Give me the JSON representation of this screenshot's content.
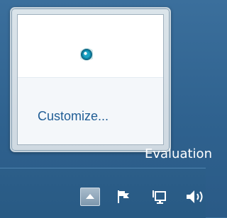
{
  "flyout": {
    "icons": [
      "tray-app-icon"
    ],
    "customize_label": "Customize..."
  },
  "desktop": {
    "watermark_text": "Evaluation"
  },
  "taskbar": {
    "tray_icons": [
      "show-hidden-icons-arrow",
      "action-center-flag-icon",
      "network-icon",
      "volume-icon"
    ]
  },
  "colors": {
    "link": "#1f5d95",
    "taskbar": "#2c5e89",
    "flyout_border": "#c6d3dc"
  }
}
